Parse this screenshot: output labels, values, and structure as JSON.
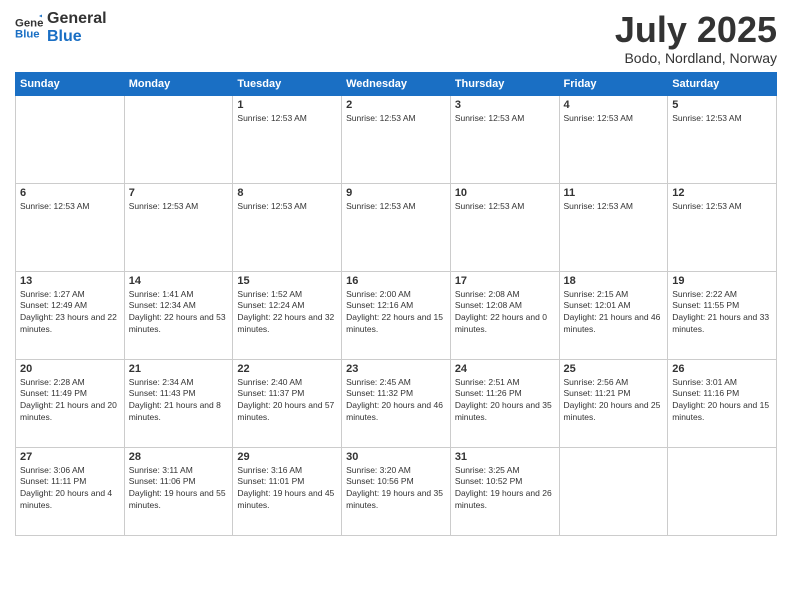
{
  "logo": {
    "line1": "General",
    "line2": "Blue"
  },
  "title": "July 2025",
  "location": "Bodo, Nordland, Norway",
  "weekdays": [
    "Sunday",
    "Monday",
    "Tuesday",
    "Wednesday",
    "Thursday",
    "Friday",
    "Saturday"
  ],
  "weeks": [
    [
      {
        "day": null,
        "info": ""
      },
      {
        "day": null,
        "info": ""
      },
      {
        "day": "1",
        "info": "Sunrise: 12:53 AM"
      },
      {
        "day": "2",
        "info": "Sunrise: 12:53 AM"
      },
      {
        "day": "3",
        "info": "Sunrise: 12:53 AM"
      },
      {
        "day": "4",
        "info": "Sunrise: 12:53 AM"
      },
      {
        "day": "5",
        "info": "Sunrise: 12:53 AM"
      }
    ],
    [
      {
        "day": "6",
        "info": "Sunrise: 12:53 AM"
      },
      {
        "day": "7",
        "info": "Sunrise: 12:53 AM"
      },
      {
        "day": "8",
        "info": "Sunrise: 12:53 AM"
      },
      {
        "day": "9",
        "info": "Sunrise: 12:53 AM"
      },
      {
        "day": "10",
        "info": "Sunrise: 12:53 AM"
      },
      {
        "day": "11",
        "info": "Sunrise: 12:53 AM"
      },
      {
        "day": "12",
        "info": "Sunrise: 12:53 AM"
      }
    ],
    [
      {
        "day": "13",
        "info": "Sunrise: 1:27 AM\nSunset: 12:49 AM\nDaylight: 23 hours and 22 minutes."
      },
      {
        "day": "14",
        "info": "Sunrise: 1:41 AM\nSunset: 12:34 AM\nDaylight: 22 hours and 53 minutes."
      },
      {
        "day": "15",
        "info": "Sunrise: 1:52 AM\nSunset: 12:24 AM\nDaylight: 22 hours and 32 minutes."
      },
      {
        "day": "16",
        "info": "Sunrise: 2:00 AM\nSunset: 12:16 AM\nDaylight: 22 hours and 15 minutes."
      },
      {
        "day": "17",
        "info": "Sunrise: 2:08 AM\nSunset: 12:08 AM\nDaylight: 22 hours and 0 minutes."
      },
      {
        "day": "18",
        "info": "Sunrise: 2:15 AM\nSunset: 12:01 AM\nDaylight: 21 hours and 46 minutes."
      },
      {
        "day": "19",
        "info": "Sunrise: 2:22 AM\nSunset: 11:55 PM\nDaylight: 21 hours and 33 minutes."
      }
    ],
    [
      {
        "day": "20",
        "info": "Sunrise: 2:28 AM\nSunset: 11:49 PM\nDaylight: 21 hours and 20 minutes."
      },
      {
        "day": "21",
        "info": "Sunrise: 2:34 AM\nSunset: 11:43 PM\nDaylight: 21 hours and 8 minutes."
      },
      {
        "day": "22",
        "info": "Sunrise: 2:40 AM\nSunset: 11:37 PM\nDaylight: 20 hours and 57 minutes."
      },
      {
        "day": "23",
        "info": "Sunrise: 2:45 AM\nSunset: 11:32 PM\nDaylight: 20 hours and 46 minutes."
      },
      {
        "day": "24",
        "info": "Sunrise: 2:51 AM\nSunset: 11:26 PM\nDaylight: 20 hours and 35 minutes."
      },
      {
        "day": "25",
        "info": "Sunrise: 2:56 AM\nSunset: 11:21 PM\nDaylight: 20 hours and 25 minutes."
      },
      {
        "day": "26",
        "info": "Sunrise: 3:01 AM\nSunset: 11:16 PM\nDaylight: 20 hours and 15 minutes."
      }
    ],
    [
      {
        "day": "27",
        "info": "Sunrise: 3:06 AM\nSunset: 11:11 PM\nDaylight: 20 hours and 4 minutes."
      },
      {
        "day": "28",
        "info": "Sunrise: 3:11 AM\nSunset: 11:06 PM\nDaylight: 19 hours and 55 minutes."
      },
      {
        "day": "29",
        "info": "Sunrise: 3:16 AM\nSunset: 11:01 PM\nDaylight: 19 hours and 45 minutes."
      },
      {
        "day": "30",
        "info": "Sunrise: 3:20 AM\nSunset: 10:56 PM\nDaylight: 19 hours and 35 minutes."
      },
      {
        "day": "31",
        "info": "Sunrise: 3:25 AM\nSunset: 10:52 PM\nDaylight: 19 hours and 26 minutes."
      },
      {
        "day": null,
        "info": ""
      },
      {
        "day": null,
        "info": ""
      }
    ]
  ]
}
